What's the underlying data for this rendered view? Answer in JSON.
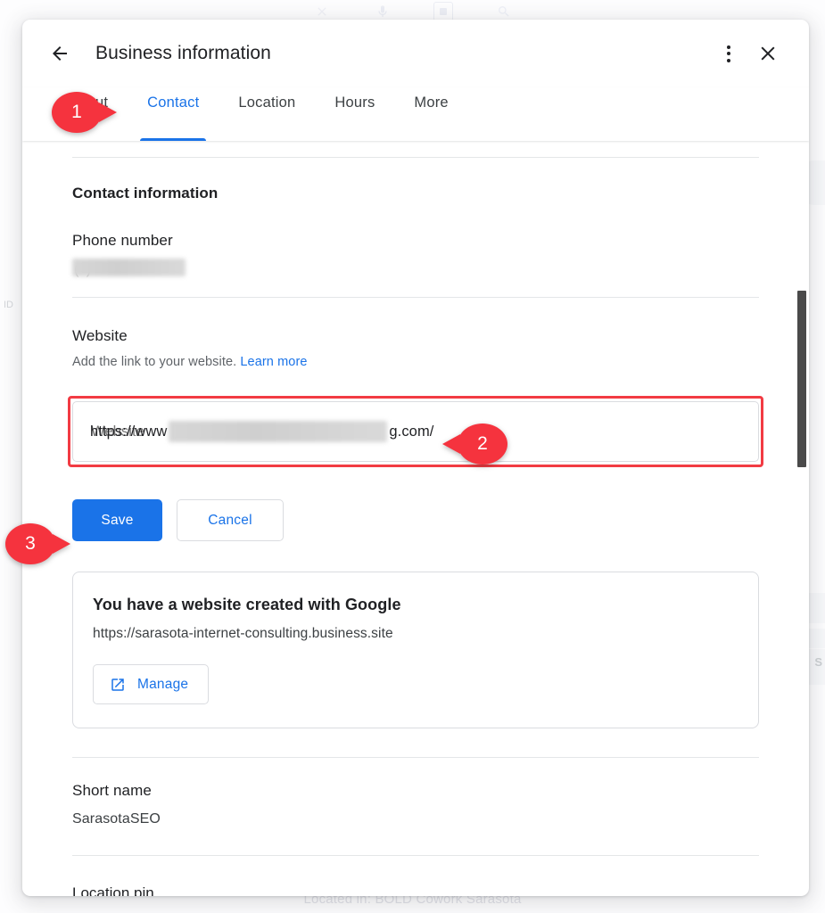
{
  "background": {
    "top_icons": [
      "close-icon",
      "microphone-icon",
      "camera-icon",
      "search-icon"
    ],
    "footnote": "Located in: BOLD Cowork Sarasota",
    "side_letter": "S"
  },
  "dialog": {
    "back_icon": "arrow-back-icon",
    "title": "Business information",
    "more_icon": "more-vert-icon",
    "close_icon": "close-icon",
    "tabs": [
      {
        "label": "About",
        "active": false
      },
      {
        "label": "Contact",
        "active": true
      },
      {
        "label": "Location",
        "active": false
      },
      {
        "label": "Hours",
        "active": false
      },
      {
        "label": "More",
        "active": false
      }
    ],
    "content": {
      "section_title": "Contact information",
      "phone": {
        "label": "Phone number",
        "value": "",
        "redacted": true
      },
      "website": {
        "label": "Website",
        "description": "Add the link to your website.",
        "learn_more": "Learn more",
        "input_prefix": "https://www",
        "input_suffix": "g.com/",
        "input_redacted": true,
        "placeholder": "Website"
      },
      "actions": {
        "save_label": "Save",
        "cancel_label": "Cancel"
      },
      "google_site_card": {
        "title": "You have a website created with Google",
        "url": "https://sarasota-internet-consulting.business.site",
        "manage_label": "Manage",
        "manage_icon": "open-in-new-icon"
      },
      "short_name": {
        "label": "Short name",
        "value": "SarasotaSEO"
      },
      "next_section_partial": "Location pin"
    }
  },
  "callouts": [
    {
      "number": "1",
      "target": "contact-tab"
    },
    {
      "number": "2",
      "target": "website-url-input"
    },
    {
      "number": "3",
      "target": "save-button"
    }
  ],
  "colors": {
    "accent_blue": "#1a73e8",
    "callout_red": "#f5333e",
    "highlight_red": "#f23b43",
    "text_primary": "#202124",
    "text_secondary": "#5f6368"
  }
}
